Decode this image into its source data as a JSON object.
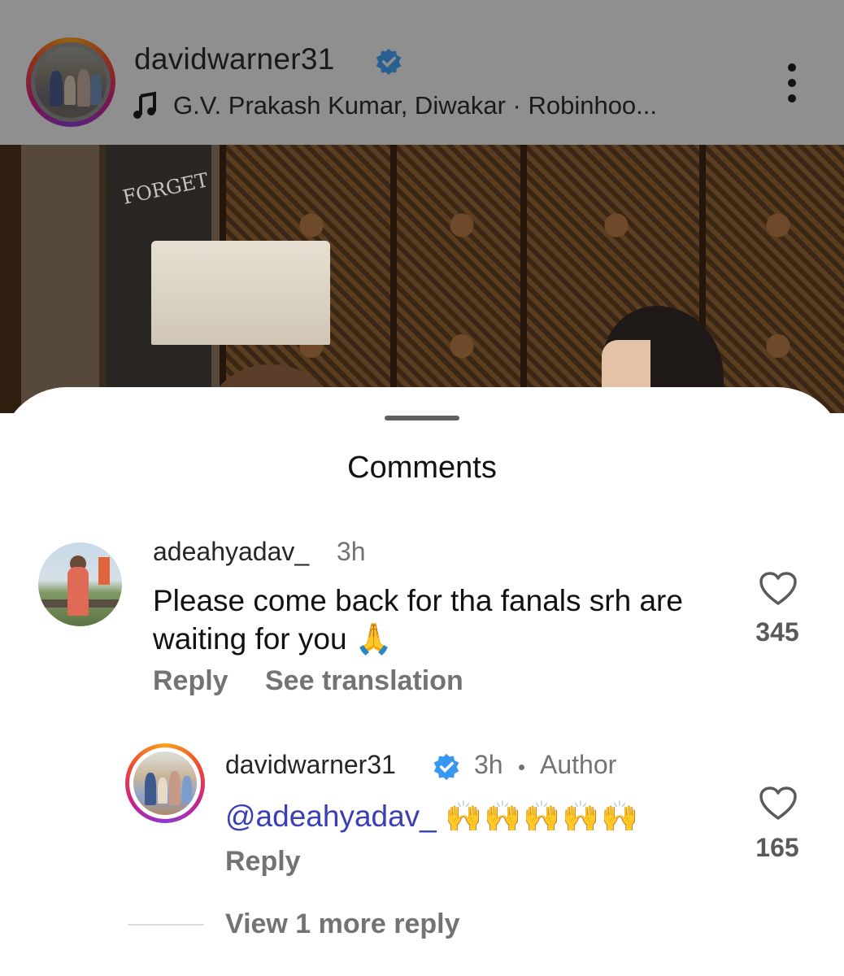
{
  "header": {
    "username": "davidwarner31",
    "verified": true,
    "audio": "G.V. Prakash Kumar, Diwakar · Robinhoo...",
    "icons": [
      "music-note-icon",
      "verified-badge-icon",
      "more-options-icon"
    ]
  },
  "video": {
    "board_text": "FORGET"
  },
  "sheet": {
    "title": "Comments"
  },
  "comments": [
    {
      "username": "adeahyadav_",
      "time": "3h",
      "text": "Please come back for tha fanals srh are waiting for you",
      "emoji": "🙏",
      "reply_label": "Reply",
      "translate_label": "See translation",
      "likes": "345"
    },
    {
      "username": "davidwarner31",
      "verified": true,
      "time": "3h",
      "author_label": "Author",
      "mention": "@adeahyadav_",
      "emoji": "🙌🙌🙌🙌🙌",
      "reply_label": "Reply",
      "likes": "165"
    }
  ],
  "more_replies_label": "View 1 more reply",
  "colors": {
    "verified_blue": "#3897f0",
    "mention": "#3b3fb6",
    "secondary_text": "#737373"
  }
}
